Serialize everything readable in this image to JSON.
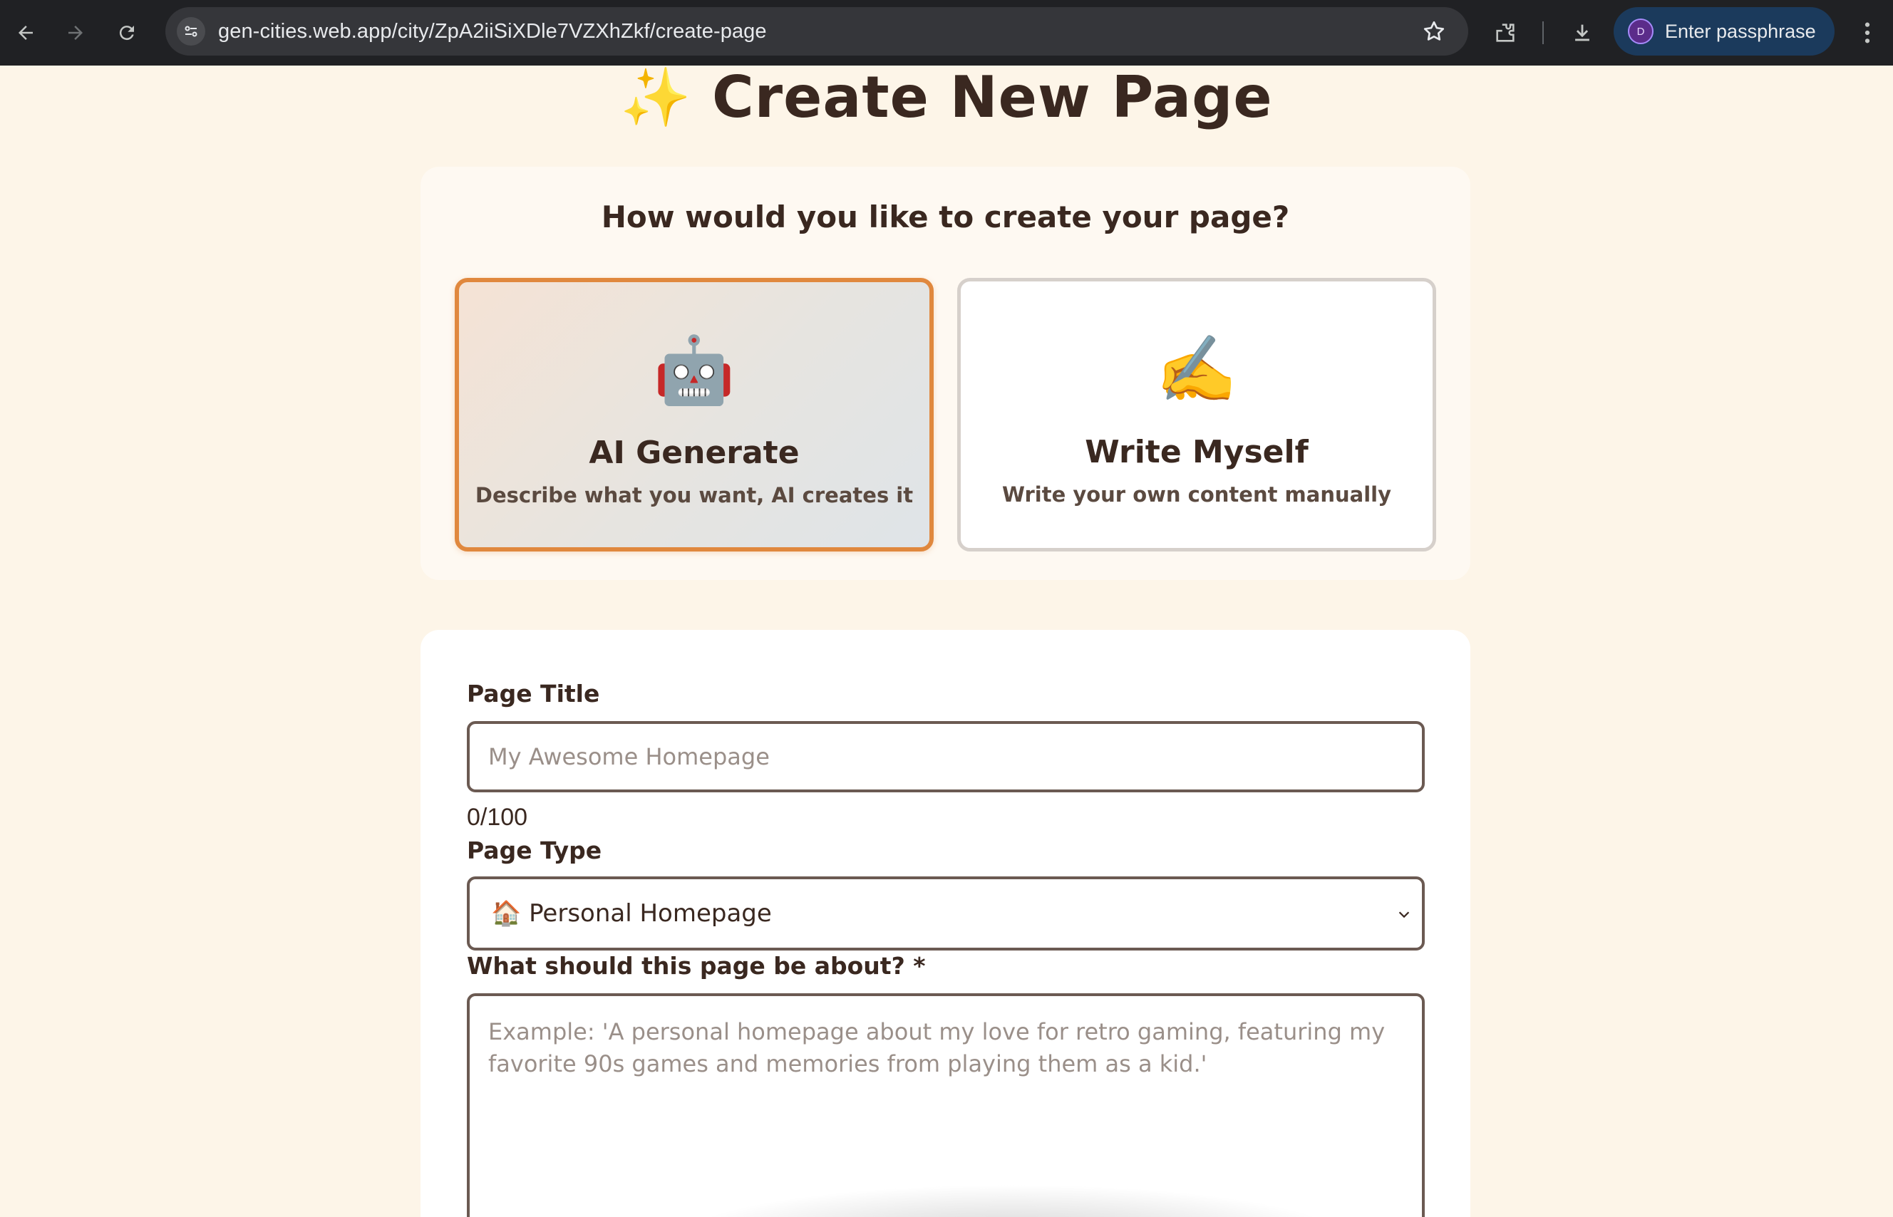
{
  "browser": {
    "url": "gen-cities.web.app/city/ZpA2iiSiXDle7VZXhZkf/create-page",
    "profile_initial": "D",
    "profile_label": "Enter passphrase"
  },
  "page": {
    "title_emoji": "✨",
    "title": "Create New Page"
  },
  "mode_selector": {
    "question": "How would you like to create your page?",
    "options": [
      {
        "emoji": "🤖",
        "title": "AI Generate",
        "description": "Describe what you want, AI creates it",
        "selected": true
      },
      {
        "emoji": "✍️",
        "title": "Write Myself",
        "description": "Write your own content manually",
        "selected": false
      }
    ]
  },
  "form": {
    "title_label": "Page Title",
    "title_placeholder": "My Awesome Homepage",
    "title_value": "",
    "title_counter": "0/100",
    "type_label": "Page Type",
    "type_selected": "🏠 Personal Homepage",
    "about_label": "What should this page be about? *",
    "about_placeholder": "Example: 'A personal homepage about my love for retro gaming, featuring my favorite 90s games and memories from playing them as a kid.'"
  },
  "colors": {
    "accent": "#e0883e",
    "background": "#fdf5e8",
    "input_border": "#6b5a52"
  }
}
